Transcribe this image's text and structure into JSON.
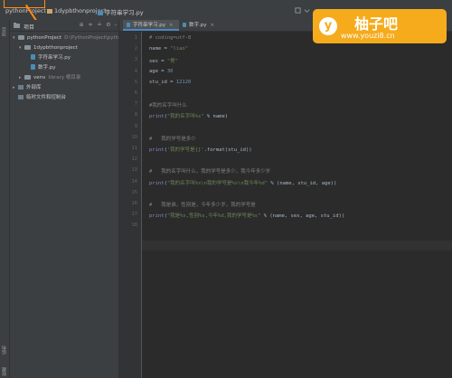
{
  "breadcrumb": {
    "project": "pythonProject",
    "folder": "1dypbthonproject",
    "file": "字符串学习.py"
  },
  "project_panel": {
    "title": "项目",
    "tree": [
      {
        "indent": 0,
        "arrow": "▾",
        "icon": "folder",
        "label": "pythonProject",
        "extra": "D:\\PythonProject\\pythonProject"
      },
      {
        "indent": 1,
        "arrow": "▾",
        "icon": "folder",
        "label": "1dypbthonproject",
        "extra": ""
      },
      {
        "indent": 2,
        "arrow": "",
        "icon": "py",
        "label": "字符串学习.py",
        "extra": ""
      },
      {
        "indent": 2,
        "arrow": "",
        "icon": "py",
        "label": "数字.py",
        "extra": ""
      },
      {
        "indent": 1,
        "arrow": "▸",
        "icon": "folder",
        "label": "venv",
        "extra": "library 根目录"
      },
      {
        "indent": 0,
        "arrow": "▸",
        "icon": "lib",
        "label": "外部库",
        "extra": ""
      },
      {
        "indent": 0,
        "arrow": "",
        "icon": "lib",
        "label": "临时文件和控制台",
        "extra": ""
      }
    ]
  },
  "tabs": [
    {
      "label": "字符串学习.py",
      "active": true
    },
    {
      "label": "数字.py",
      "active": false
    }
  ],
  "code_lines": [
    [
      {
        "t": "# coding=utf-8",
        "c": "com"
      }
    ],
    [
      {
        "t": "name = ",
        "c": "def"
      },
      {
        "t": "\"liao\"",
        "c": "str"
      }
    ],
    [
      {
        "t": "sex = ",
        "c": "def"
      },
      {
        "t": "\"男\"",
        "c": "str"
      }
    ],
    [
      {
        "t": "age = ",
        "c": "def"
      },
      {
        "t": "30",
        "c": "num"
      }
    ],
    [
      {
        "t": "stu_id = ",
        "c": "def"
      },
      {
        "t": "12120",
        "c": "num"
      }
    ],
    [],
    [
      {
        "t": "#我的名字叫什么",
        "c": "com"
      }
    ],
    [
      {
        "t": "print",
        "c": "fn"
      },
      {
        "t": "(",
        "c": "def"
      },
      {
        "t": "\"我的名字叫%s\"",
        "c": "str"
      },
      {
        "t": " % name)",
        "c": "def"
      }
    ],
    [],
    [
      {
        "t": "#   我的学号是多少",
        "c": "com"
      }
    ],
    [
      {
        "t": "print",
        "c": "fn"
      },
      {
        "t": "(",
        "c": "def"
      },
      {
        "t": "'我的学号是{}'",
        "c": "str"
      },
      {
        "t": ".format(stu_id))",
        "c": "def"
      }
    ],
    [],
    [
      {
        "t": "#   我的名字叫什么，我的学号是多少，我今年多少岁",
        "c": "com"
      }
    ],
    [
      {
        "t": "print",
        "c": "fn"
      },
      {
        "t": "(",
        "c": "def"
      },
      {
        "t": "\"我的名字叫%s\\n我的学号是%s\\n我今年%d\"",
        "c": "str"
      },
      {
        "t": " % (name, stu_id, age))",
        "c": "def"
      }
    ],
    [],
    [
      {
        "t": "#   我是谁，性别是，今年多少岁，我的学号是",
        "c": "com"
      }
    ],
    [
      {
        "t": "print",
        "c": "fn"
      },
      {
        "t": "(",
        "c": "def"
      },
      {
        "t": "\"我是%s,性别%s,今年%d,我的学号是%s\"",
        "c": "str"
      },
      {
        "t": " % (name, sex, age, stu_id))",
        "c": "def"
      }
    ],
    []
  ],
  "left_strip": {
    "tabs": [
      "项目",
      "结构",
      "收藏"
    ]
  },
  "watermark": {
    "logo": "y",
    "title": "柚子吧",
    "url": "www.youzi8.cn"
  },
  "colors": {
    "accent": "#4a88c7",
    "annotation": "#ff8c1a",
    "watermark": "#f5ab1c"
  }
}
